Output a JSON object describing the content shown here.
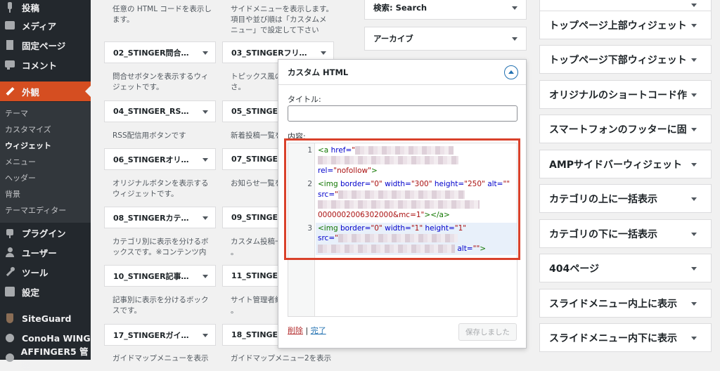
{
  "admin_menu": {
    "items": [
      {
        "label": "投稿",
        "icon": "pin-icon"
      },
      {
        "label": "メディア",
        "icon": "media-icon"
      },
      {
        "label": "固定ページ",
        "icon": "page-icon"
      },
      {
        "label": "コメント",
        "icon": "comment-icon"
      },
      {
        "label": "外観",
        "icon": "brush-icon"
      }
    ],
    "submenu": [
      "テーマ",
      "カスタマイズ",
      "ウィジェット",
      "メニュー",
      "ヘッダー",
      "背景",
      "テーマエディター"
    ],
    "items_lower": [
      {
        "label": "プラグイン",
        "icon": "plugin-icon"
      },
      {
        "label": "ユーザー",
        "icon": "user-icon"
      },
      {
        "label": "ツール",
        "icon": "wrench-icon"
      },
      {
        "label": "設定",
        "icon": "settings-icon"
      },
      {
        "label": "SiteGuard",
        "icon": "shield-icon"
      },
      {
        "label": "ConoHa WING",
        "icon": "gear-icon"
      },
      {
        "label": "AFFINGER5 管理",
        "icon": "gear-icon"
      }
    ]
  },
  "available_widgets": {
    "top_descriptions": [
      "任意の HTML コードを表示し\nます。",
      "サイドメニューを表示します。\n項目や並び順は「カスタムメ\nニュー」で設定して下さい"
    ],
    "left": [
      {
        "title": "02_STINGER問合…",
        "desc": "問合せボタンを表示するウィ\nジェットです。"
      },
      {
        "title": "04_STINGER_RS…",
        "desc": "RSS配信用ボタンです"
      },
      {
        "title": "06_STINGERオリ…",
        "desc": "オリジナルボタンを表示する\nウィジェットです。"
      },
      {
        "title": "08_STINGERカテ…",
        "desc": "カテゴリ別に表示を分けるボ\nックスです。※コンテンツ内"
      },
      {
        "title": "10_STINGER記事…",
        "desc": "記事別に表示を分けるボック\nスです。"
      },
      {
        "title": "17_STINGERガイ…",
        "desc": "ガイドマップメニューを表示"
      }
    ],
    "right": [
      {
        "title": "03_STINGERフリ…",
        "desc": "トピックス風の\nさ。"
      },
      {
        "title": "05_STINGER",
        "desc": "新着投稿一覧を"
      },
      {
        "title": "07_STINGER",
        "desc": "お知らせ一覧を"
      },
      {
        "title": "09_STINGER",
        "desc": "カスタム投稿一\n。"
      },
      {
        "title": "11_STINGER",
        "desc": "サイト管理者紹\n。"
      },
      {
        "title": "18_STINGER",
        "desc": "ガイドマップメニュー2を表示"
      }
    ]
  },
  "sidebar_area": {
    "widgets": [
      "検索: Search",
      "アーカイブ"
    ]
  },
  "custom_html": {
    "header": "カスタム HTML",
    "title_label": "タイトル:",
    "title_value": "",
    "content_label": "内容:",
    "code_lines": {
      "n1": "1",
      "n2": "2",
      "n3": "3",
      "l1_open": "<a",
      "l1_attr": " href=",
      "l1_q": "\"",
      "l1_rel_attr": "rel=",
      "l1_rel_val": "\"nofollow\"",
      "l1_close": ">",
      "l2_img": "<img",
      "l2_a1": " border=",
      "l2_v1": "\"0\"",
      "l2_a2": " width=",
      "l2_v2": "\"300\"",
      "l2_a3": " height=",
      "l2_v3": "\"250\"",
      "l2_a4": " alt=",
      "l2_v4": "\"\"",
      "l2_src": "src=",
      "l2_srcq": "\"",
      "l2_tail": "0000002006302000&mc=1\"",
      "l2_end": "></a>",
      "l3_img": "<img",
      "l3_a1": " border=",
      "l3_v1": "\"0\"",
      "l3_a2": " width=",
      "l3_v2": "\"1\"",
      "l3_a3": " height=",
      "l3_v3": "\"1\"",
      "l3_src": "src=",
      "l3_srcq": "\"",
      "l3_alt": " alt=",
      "l3_altv": "\"\"",
      "l3_end": ">"
    },
    "delete_label": "削除",
    "separator": " | ",
    "done_label": "完了",
    "save_label": "保存しました"
  },
  "right_widgets": [
    "トップページ上部ウィジェット",
    "トップページ下部ウィジェット",
    "オリジナルのショートコード作",
    "スマートフォンのフッターに固",
    "AMPサイドバーウィジェット",
    "カテゴリの上に一括表示",
    "カテゴリの下に一括表示",
    "404ページ",
    "スライドメニュー内上に表示",
    "スライドメニュー内下に表示"
  ],
  "colors": {
    "accent": "#d54e21",
    "highlight_border": "#d9412b",
    "link": "#2271b1",
    "delete": "#b32d2e"
  }
}
